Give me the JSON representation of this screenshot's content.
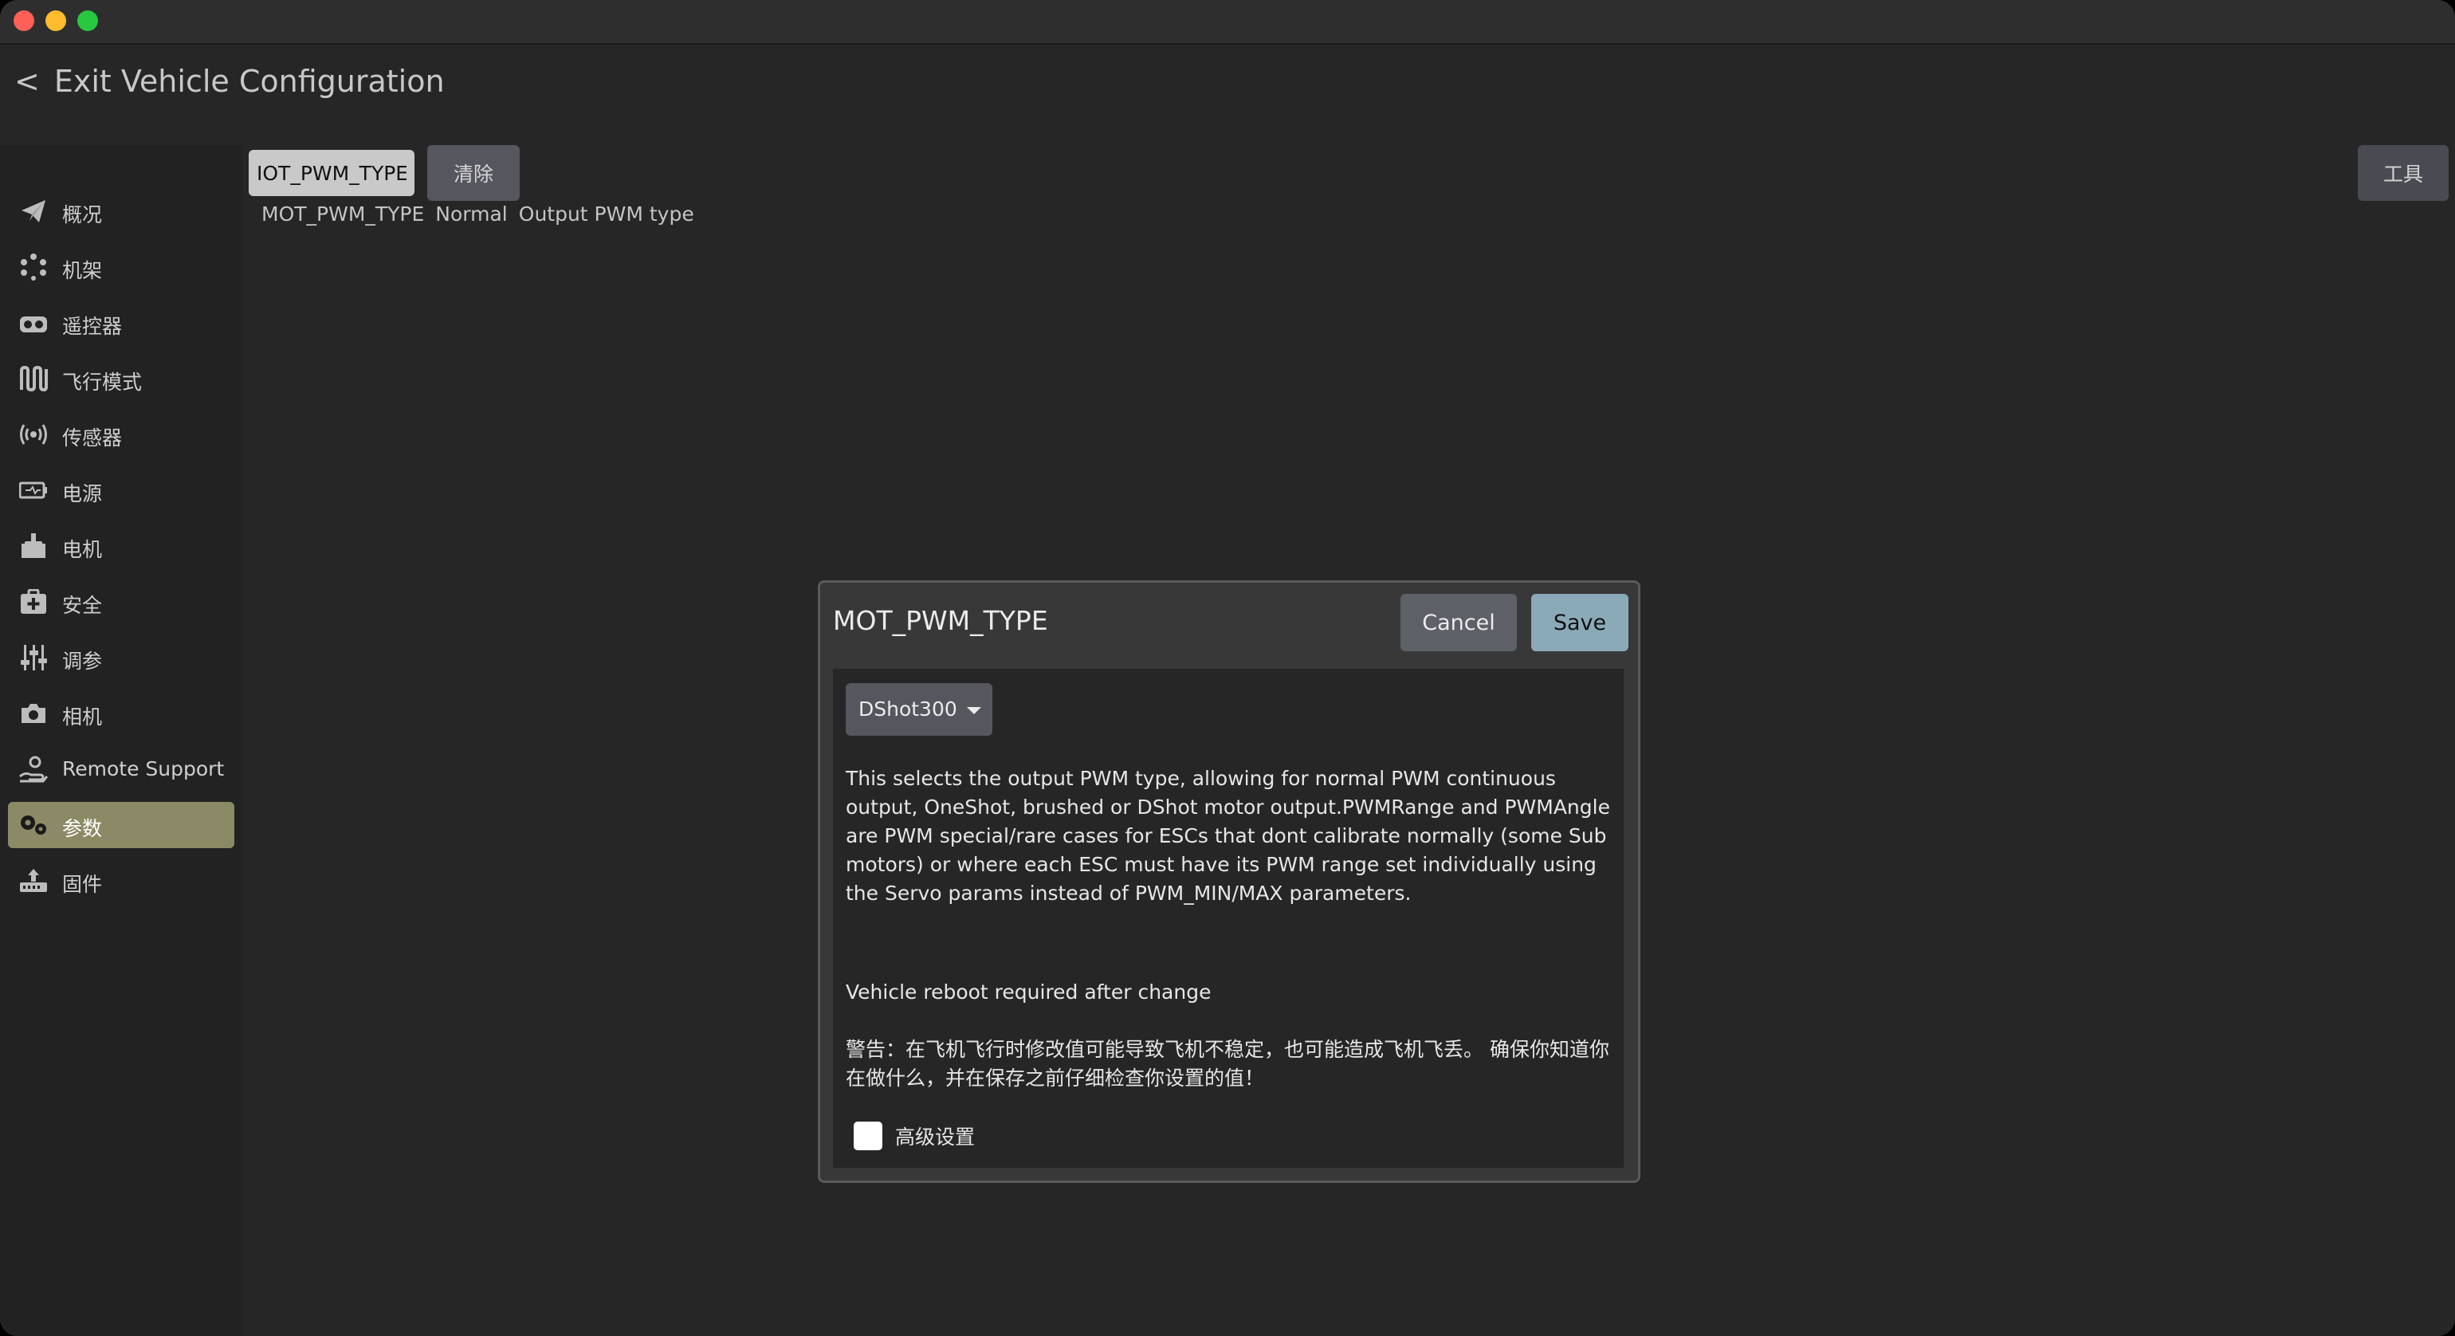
{
  "window": {
    "controls": [
      "close",
      "minimize",
      "maximize"
    ]
  },
  "header": {
    "back_chevron": "<",
    "exit_label": "Exit Vehicle Configuration"
  },
  "sidebar": {
    "items": [
      {
        "label": "概况",
        "icon": "paper-plane-icon"
      },
      {
        "label": "机架",
        "icon": "airframe-dots-icon"
      },
      {
        "label": "遥控器",
        "icon": "radio-controller-icon"
      },
      {
        "label": "飞行模式",
        "icon": "flight-modes-icon"
      },
      {
        "label": "传感器",
        "icon": "sensor-signal-icon"
      },
      {
        "label": "电源",
        "icon": "battery-icon"
      },
      {
        "label": "电机",
        "icon": "motor-icon"
      },
      {
        "label": "安全",
        "icon": "first-aid-kit-icon"
      },
      {
        "label": "调参",
        "icon": "sliders-icon"
      },
      {
        "label": "相机",
        "icon": "camera-icon"
      },
      {
        "label": "Remote Support",
        "icon": "hand-support-icon"
      },
      {
        "label": "参数",
        "icon": "gears-icon",
        "active": true
      },
      {
        "label": "固件",
        "icon": "firmware-upload-icon"
      }
    ]
  },
  "toolbar": {
    "search_value": "IOT_PWM_TYPE",
    "clear_label": "清除",
    "tools_label": "工具"
  },
  "param_row": {
    "name": "MOT_PWM_TYPE",
    "value": "Normal",
    "description": "Output PWM type"
  },
  "dialog": {
    "title": "MOT_PWM_TYPE",
    "cancel_label": "Cancel",
    "save_label": "Save",
    "selected_value": "DShot300",
    "description": "This selects the output PWM type, allowing for normal PWM continuous output, OneShot, brushed or DShot motor output.PWMRange and PWMAngle are PWM special/rare cases for ESCs that dont calibrate normally (some Sub motors) or where each ESC must have its PWM range set individually using the Servo params instead of PWM_MIN/MAX parameters.",
    "reboot_note": "Vehicle reboot required after change",
    "warning": "警告：在飞机飞行时修改值可能导致飞机不稳定，也可能造成飞机飞丢。 确保你知道你在做什么，并在保存之前仔细检查你设置的值！",
    "advanced_label": "高级设置",
    "advanced_checked": false
  },
  "colors": {
    "background": "#262626",
    "sidebar_active": "#8c8a66",
    "save_button": "#8aaab8",
    "button": "#55565e"
  }
}
